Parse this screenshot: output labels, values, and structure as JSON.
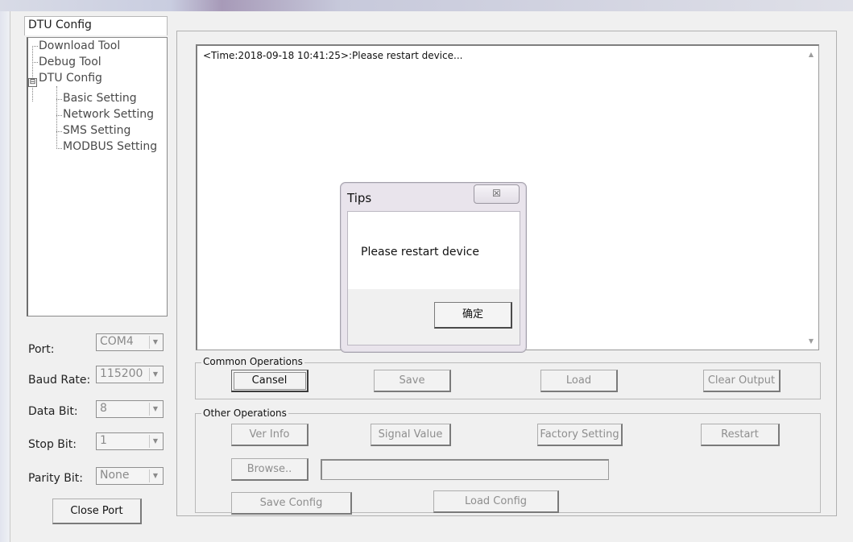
{
  "window": {
    "title": "DTU Config"
  },
  "tree": {
    "items": [
      {
        "label": "Download Tool"
      },
      {
        "label": "Debug Tool"
      },
      {
        "label": "DTU Config",
        "expander": "⊟"
      },
      {
        "label": "Basic Setting"
      },
      {
        "label": "Network Setting"
      },
      {
        "label": "SMS Setting"
      },
      {
        "label": "MODBUS Setting"
      }
    ]
  },
  "serial": {
    "port": {
      "label": "Port:",
      "value": "COM4"
    },
    "baud": {
      "label": "Baud Rate:",
      "value": "115200"
    },
    "data_bit": {
      "label": "Data Bit:",
      "value": "8"
    },
    "stop_bit": {
      "label": "Stop Bit:",
      "value": "1"
    },
    "parity_bit": {
      "label": "Parity Bit:",
      "value": "None"
    },
    "close_port_label": "Close Port"
  },
  "output": {
    "log_line": "<Time:2018-09-18 10:41:25>:Please restart device..."
  },
  "common_ops": {
    "title": "Common Operations",
    "cancel": "Cansel",
    "save": "Save",
    "load": "Load",
    "clear_output": "Clear Output"
  },
  "other_ops": {
    "title": "Other Operations",
    "ver_info": "Ver Info",
    "signal_value": "Signal Value",
    "factory_setting": "Factory Setting",
    "restart": "Restart",
    "browse": "Browse..",
    "path_value": "",
    "save_config": "Save Config",
    "load_config": "Load Config"
  },
  "dialog": {
    "title": "Tips",
    "close_glyph": "☒",
    "message": "Please restart device",
    "ok_label": "确定"
  },
  "icons": {
    "dropdown": "chevron-down-icon",
    "close": "close-icon",
    "tree_expander": "minus-box-icon"
  }
}
